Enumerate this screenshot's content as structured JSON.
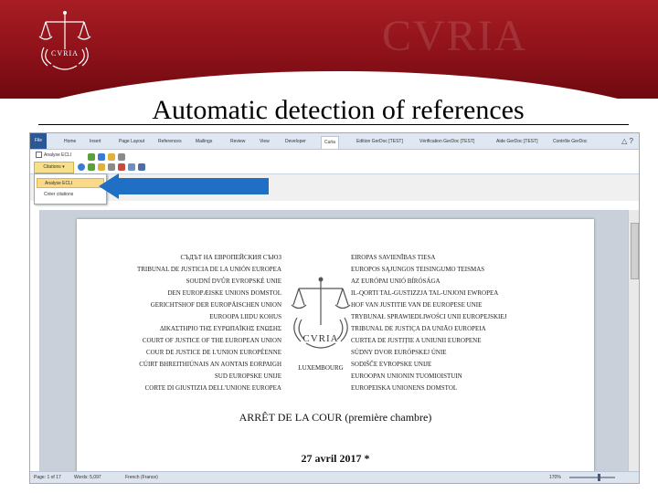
{
  "slide": {
    "watermark": "CVRIA",
    "logo_text": "CVRIA",
    "title": "Automatic detection of references"
  },
  "word": {
    "tabs": [
      "File",
      "Home",
      "Insert",
      "Page Layout",
      "References",
      "Mailings",
      "Review",
      "View",
      "Developer",
      "Curia",
      "Edition GerDoc [TEST]",
      "Vérification GerDoc [TEST]",
      "Aide GerDoc [TEST]",
      "Contrôle GerDoc"
    ],
    "ribbon": {
      "checkbox_label": "Analyse ECLI",
      "citations_button": "Citations ▾"
    },
    "menu": [
      "Analyse ECLI",
      "Créer citations"
    ],
    "page": {
      "courts_left": [
        "СЪДЪТ НА ЕВРОПЕЙСКИЯ СЪЮЗ",
        "TRIBUNAL DE JUSTICIA DE LA UNIÓN EUROPEA",
        "SOUDNÍ DVŮR EVROPSKÉ UNIE",
        "DEN EUROPÆISKE UNIONS DOMSTOL",
        "GERICHTSHOF DER EUROPÄISCHEN UNION",
        "EUROOPA LIIDU KOHUS",
        "ΔΙΚΑΣΤΗΡΙΟ ΤΗΣ ΕΥΡΩΠΑΪΚΗΣ ΕΝΩΣΗΣ",
        "COURT OF JUSTICE OF THE EUROPEAN UNION",
        "COUR DE JUSTICE DE L'UNION EUROPÉENNE",
        "CÚIRT BHREITHIÚNAIS AN AONTAIS EORPAIGH",
        "SUD EUROPSKE UNIJE",
        "CORTE DI GIUSTIZIA DELL'UNIONE EUROPEA"
      ],
      "courts_right": [
        "EIROPAS SAVIENĪBAS TIESA",
        "EUROPOS SĄJUNGOS TEISINGUMO TEISMAS",
        "AZ EURÓPAI UNIÓ BÍRÓSÁGA",
        "IL-QORTI TAL-GUSTIZZJA TAL-UNJONI EWROPEA",
        "HOF VAN JUSTITIE VAN DE EUROPESE UNIE",
        "TRYBUNAŁ SPRAWIEDLIWOŚCI UNII EUROPEJSKIEJ",
        "TRIBUNAL DE JUSTIÇA DA UNIÃO EUROPEIA",
        "CURTEA DE JUSTIȚIE A UNIUNII EUROPENE",
        "SÚDNY DVOR EURÓPSKEJ ÚNIE",
        "SODIŠČE EVROPSKE UNIJE",
        "EUROOPAN UNIONIN TUOMIOISTUIN",
        "EUROPEISKA UNIONENS DOMSTOL"
      ],
      "emblem_text": "CVRIA",
      "city": "LUXEMBOURG",
      "arret": "ARRÊT DE LA COUR (première chambre)",
      "date": "27 avril 2017 *"
    },
    "status": {
      "page": "Page: 1 of 17",
      "words": "Words: 5,097",
      "language": "French (France)",
      "zoom": "170%"
    }
  },
  "colors": {
    "header_red": "#8d1119",
    "arrow_blue": "#1f6fc5",
    "highlight": "#f9d98a"
  }
}
